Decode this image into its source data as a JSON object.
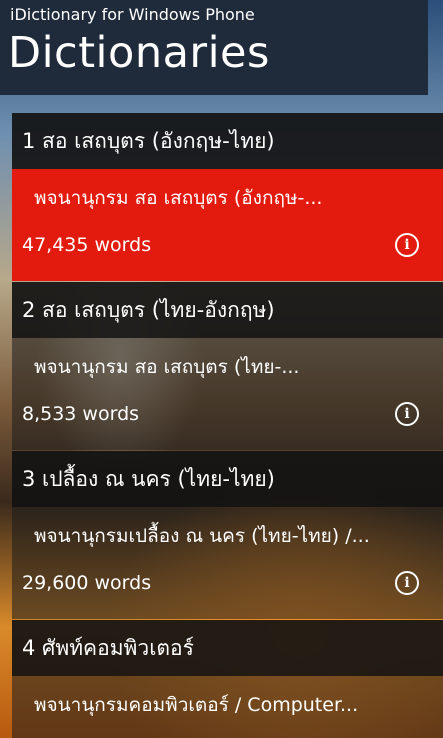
{
  "header": {
    "app_title": "iDictionary for Windows Phone",
    "page_title": "Dictionaries"
  },
  "dictionaries": [
    {
      "name": "1  สอ เสถบุตร (อังกฤษ-ไทย)",
      "description": "พจนานุกรม สอ เสถบุตร (อังกฤษ-...",
      "word_count": "47,435 words",
      "selected": true
    },
    {
      "name": "2  สอ เสถบุตร (ไทย-อังกฤษ)",
      "description": "พจนานุกรม สอ เสถบุตร (ไทย-...",
      "word_count": "8,533 words",
      "selected": false
    },
    {
      "name": "3  เปลื้อง ณ นคร (ไทย-ไทย)",
      "description": "พจนานุกรมเปลื้อง ณ นคร (ไทย-ไทย) /...",
      "word_count": "29,600 words",
      "selected": false
    },
    {
      "name": "4  ศัพท์คอมพิวเตอร์",
      "description": "พจนานุกรมคอมพิวเตอร์ / Computer...",
      "selected": false
    }
  ],
  "icons": {
    "info": "info-icon"
  },
  "colors": {
    "accent": "#e31a0e",
    "header_bg": "#1f2a3a",
    "item_header_bg": "#121212"
  }
}
